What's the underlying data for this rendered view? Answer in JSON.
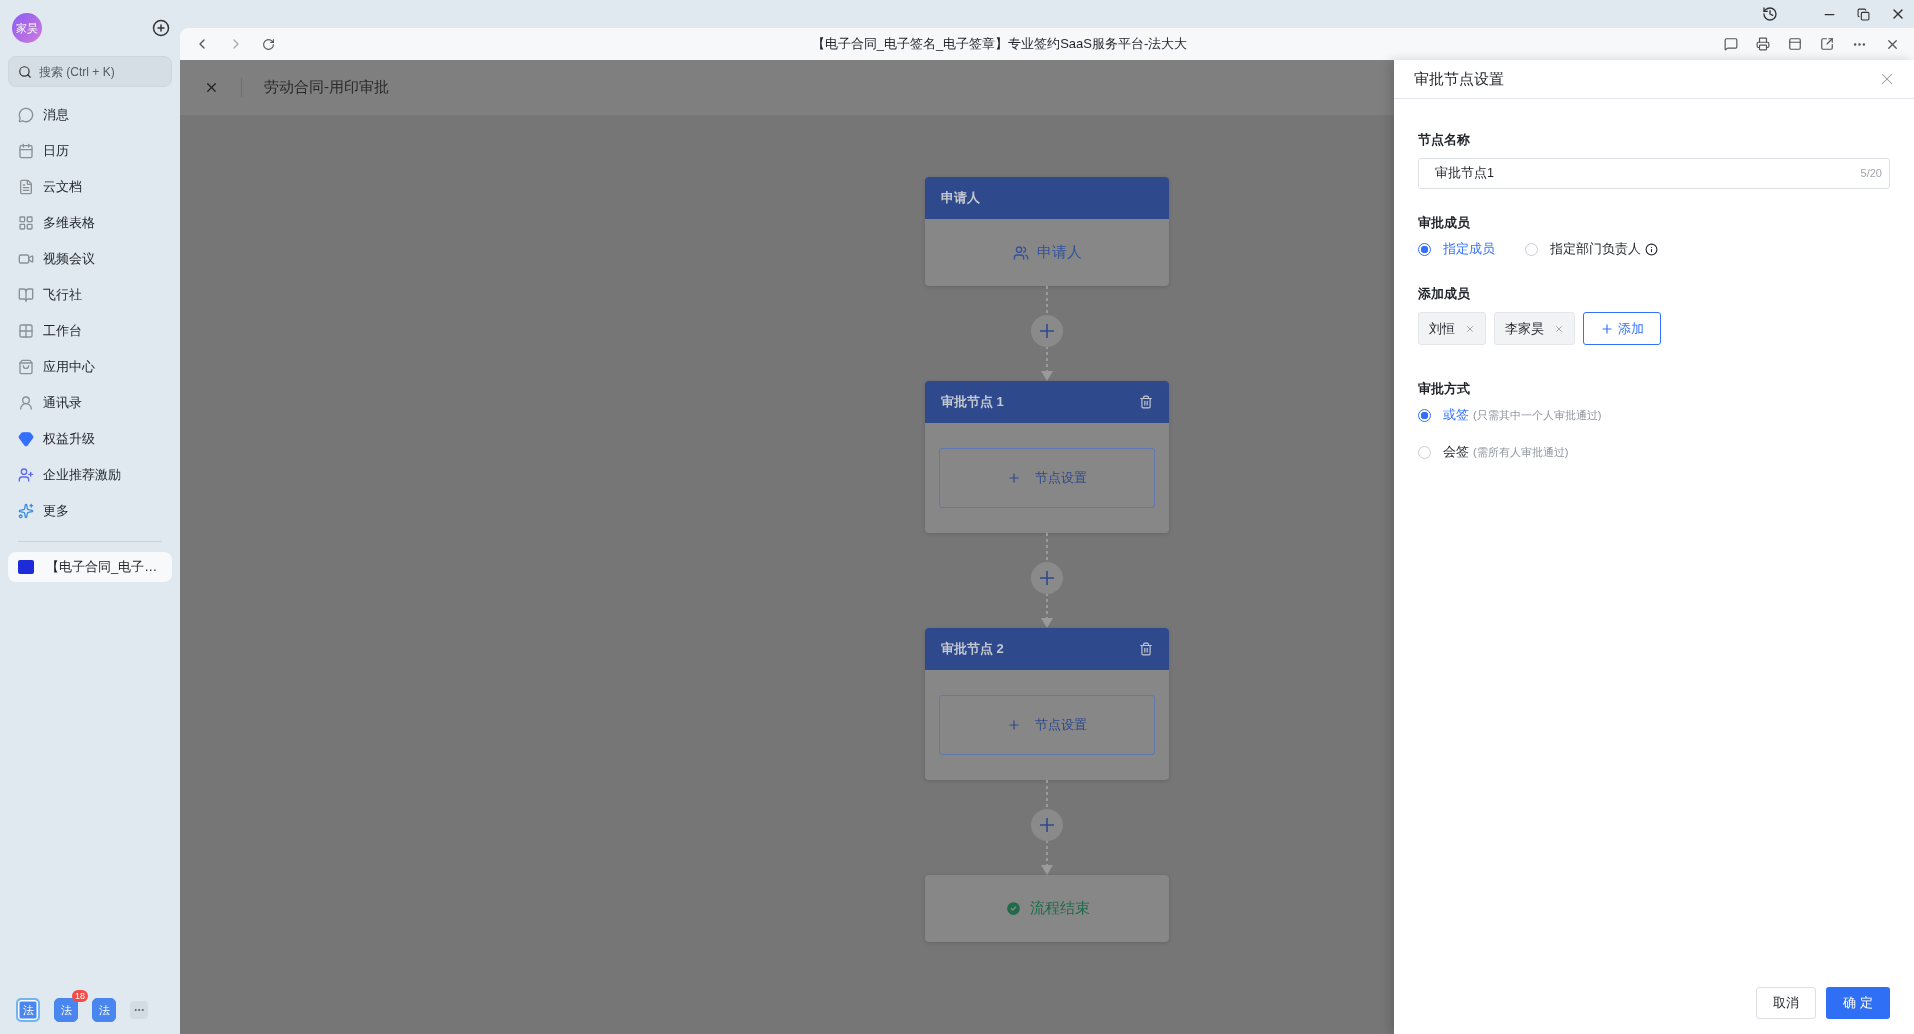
{
  "sidebar": {
    "avatar": "家昊",
    "search": {
      "placeholder": "搜索 (Ctrl + K)"
    },
    "items": [
      {
        "label": "消息"
      },
      {
        "label": "日历"
      },
      {
        "label": "云文档"
      },
      {
        "label": "多维表格"
      },
      {
        "label": "视频会议"
      },
      {
        "label": "飞行社"
      },
      {
        "label": "工作台"
      },
      {
        "label": "应用中心"
      },
      {
        "label": "通讯录"
      },
      {
        "label": "权益升级"
      },
      {
        "label": "企业推荐激励"
      },
      {
        "label": "更多"
      }
    ],
    "open_tabs": [
      {
        "label": "【电子合同_电子…",
        "selected": true
      }
    ],
    "dock": [
      {
        "label": "法",
        "selected": true
      },
      {
        "label": "法",
        "selected": false,
        "badge": "18"
      },
      {
        "label": "法",
        "selected": false
      }
    ]
  },
  "browser": {
    "title": "【电子合同_电子签名_电子签章】专业签约SaaS服务平台-法大大"
  },
  "dialog": {
    "title": "劳动合同-用印审批"
  },
  "flow": {
    "nodes": [
      {
        "kind": "start",
        "title": "申请人",
        "body": "申请人"
      },
      {
        "kind": "approval",
        "title": "审批节点 1",
        "action": "节点设置"
      },
      {
        "kind": "approval",
        "title": "审批节点 2",
        "action": "节点设置"
      },
      {
        "kind": "end",
        "body": "流程结束"
      }
    ]
  },
  "drawer": {
    "title": "审批节点设置",
    "name_field": {
      "label": "节点名称",
      "value": "审批节点1",
      "count": "5/20"
    },
    "members": {
      "label": "审批成员",
      "options": [
        {
          "label": "指定成员",
          "selected": true,
          "info": false
        },
        {
          "label": "指定部门负责人",
          "selected": false,
          "info": true
        }
      ]
    },
    "add_members": {
      "label": "添加成员",
      "tags": [
        "刘恒",
        "李家昊"
      ],
      "add_button": "添加"
    },
    "method": {
      "label": "审批方式",
      "options": [
        {
          "label": "或签",
          "hint": "(只需其中一个人审批通过)",
          "selected": true
        },
        {
          "label": "会签",
          "hint": "(需所有人审批通过)",
          "selected": false
        }
      ]
    },
    "buttons": {
      "cancel": "取消",
      "ok": "确 定"
    }
  }
}
